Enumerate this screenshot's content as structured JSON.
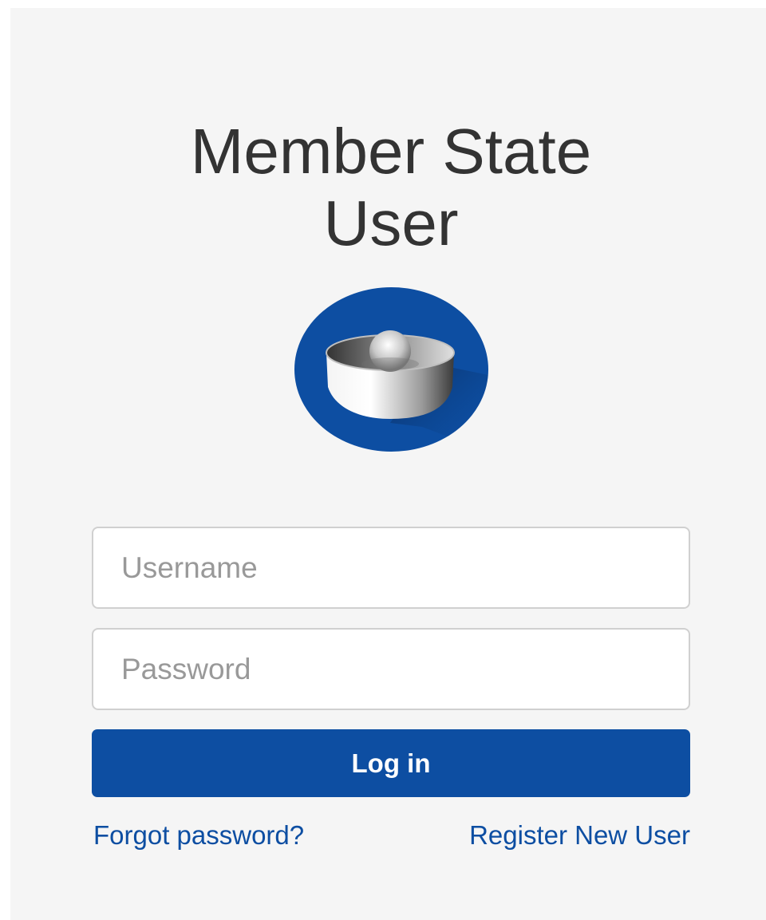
{
  "page": {
    "title_line1": "Member State",
    "title_line2": "User"
  },
  "logo": {
    "icon": "agency-logo-icon",
    "primary_color": "#0d4ea2"
  },
  "form": {
    "username_placeholder": "Username",
    "username_value": "",
    "password_placeholder": "Password",
    "password_value": "",
    "login_label": "Log in"
  },
  "links": {
    "forgot_password": "Forgot password?",
    "register": "Register New User"
  },
  "colors": {
    "accent": "#0d4ea2",
    "background": "#f5f5f5",
    "title_text": "#333333"
  }
}
